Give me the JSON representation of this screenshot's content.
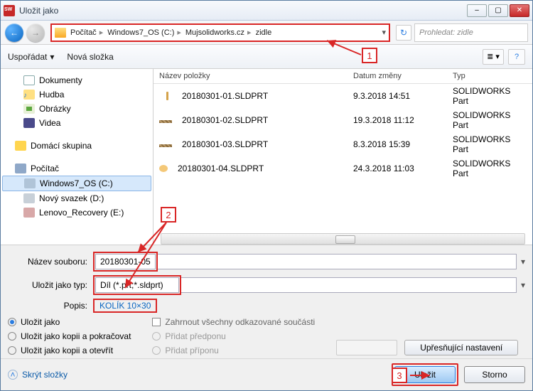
{
  "window": {
    "title": "Uložit jako"
  },
  "nav": {
    "crumbs": [
      "Počítač",
      "Windows7_OS (C:)",
      "Mujsolidworks.cz",
      "zidle"
    ],
    "search_placeholder": "Prohledat: zidle"
  },
  "toolbar": {
    "organize": "Uspořádat",
    "new_folder": "Nová složka"
  },
  "navpane": {
    "libraries": [
      {
        "label": "Dokumenty",
        "iconcls": "ni-doc"
      },
      {
        "label": "Hudba",
        "iconcls": "ni-music"
      },
      {
        "label": "Obrázky",
        "iconcls": "ni-pic"
      },
      {
        "label": "Videa",
        "iconcls": "ni-video"
      }
    ],
    "homegroup": "Domácí skupina",
    "computer": "Počítač",
    "drives": [
      {
        "label": "Windows7_OS (C:)",
        "iconcls": "ni-drive",
        "selected": true
      },
      {
        "label": "Nový svazek (D:)",
        "iconcls": "ni-drive2"
      },
      {
        "label": "Lenovo_Recovery (E:)",
        "iconcls": "ni-drive3"
      }
    ]
  },
  "filelist": {
    "headers": {
      "name": "Název položky",
      "date": "Datum změny",
      "type": "Typ"
    },
    "rows": [
      {
        "name": "20180301-01.SLDPRT",
        "date": "9.3.2018 14:51",
        "type": "SOLIDWORKS Part",
        "iconcls": "p1"
      },
      {
        "name": "20180301-02.SLDPRT",
        "date": "19.3.2018 11:12",
        "type": "SOLIDWORKS Part",
        "iconcls": "p2"
      },
      {
        "name": "20180301-03.SLDPRT",
        "date": "8.3.2018 15:39",
        "type": "SOLIDWORKS Part",
        "iconcls": "p2"
      },
      {
        "name": "20180301-04.SLDPRT",
        "date": "24.3.2018 11:03",
        "type": "SOLIDWORKS Part",
        "iconcls": "p4"
      }
    ]
  },
  "form": {
    "filename_label": "Název souboru:",
    "filename_value": "20180301-05",
    "savetype_label": "Uložit jako typ:",
    "savetype_value": "Díl (*.prt;*.sldprt)",
    "desc_label": "Popis:",
    "desc_value": "KOLÍK 10×30"
  },
  "options": {
    "saveas": "Uložit jako",
    "saveas_copy_continue": "Uložit jako kopii a pokračovat",
    "saveas_copy_open": "Uložit jako kopii a otevřít",
    "include_refs": "Zahrnout všechny odkazované součásti",
    "add_prefix": "Přidat předponu",
    "add_suffix": "Přidat příponu",
    "advanced_settings": "Upřesňující nastavení"
  },
  "footer": {
    "hide_folders": "Skrýt složky",
    "save": "Uložit",
    "cancel": "Storno"
  },
  "annotations": {
    "a1": "1",
    "a2": "2",
    "a3": "3"
  }
}
